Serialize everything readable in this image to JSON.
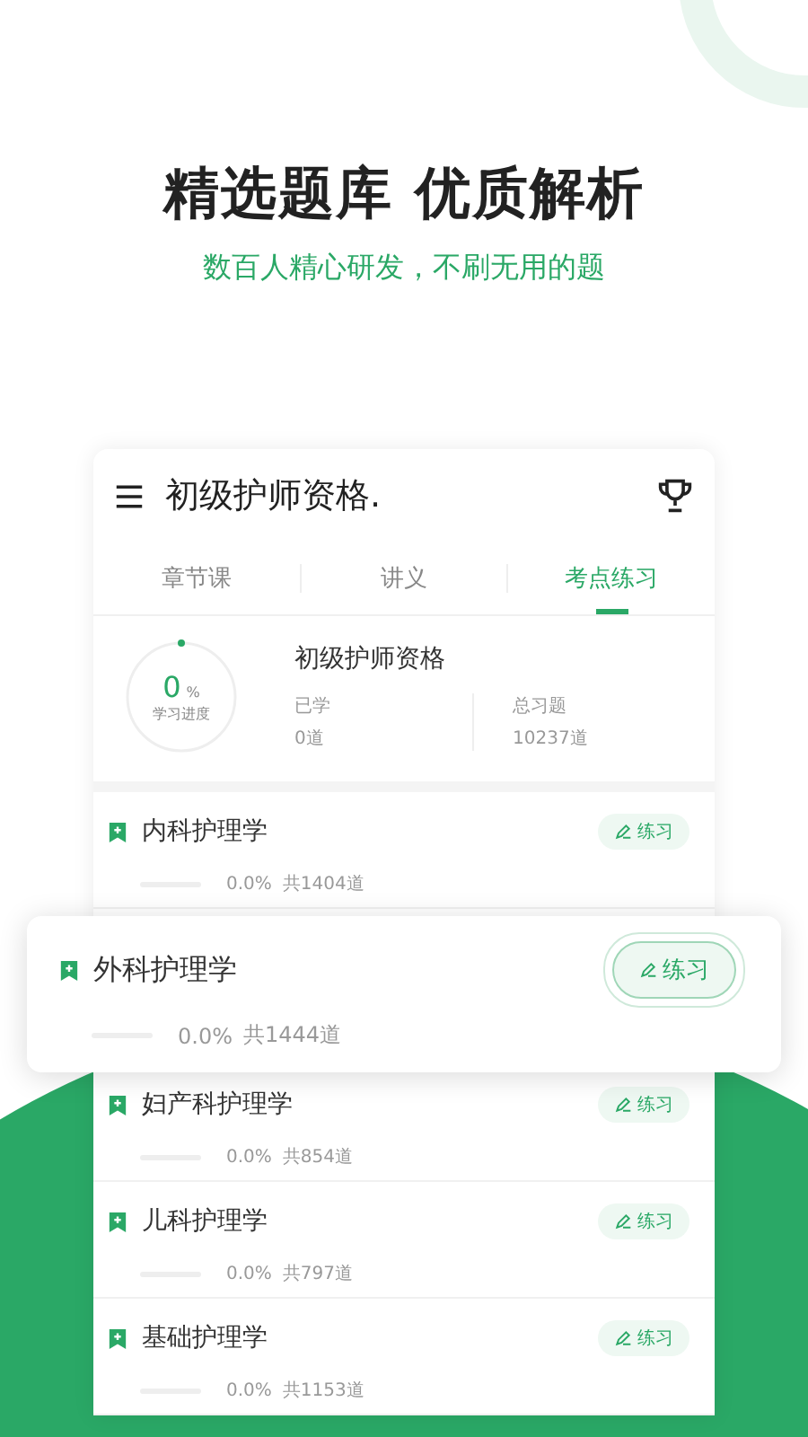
{
  "headline": "精选题库 优质解析",
  "subtitle": "数百人精心研发，不刷无用的题",
  "app": {
    "title": "初级护师资格.",
    "tabs": [
      {
        "label": "章节课",
        "selected": false
      },
      {
        "label": "讲义",
        "selected": false
      },
      {
        "label": "考点练习",
        "selected": true
      }
    ],
    "summary": {
      "percent": "0",
      "unit": "%",
      "progress_label": "学习进度",
      "name": "初级护师资格",
      "learned_label": "已学",
      "learned_value": "0道",
      "total_label": "总习题",
      "total_value": "10237道"
    },
    "subjects": [
      {
        "name": "内科护理学",
        "percent": "0.0%",
        "count": "共1404道",
        "button": "练习",
        "highlighted": false
      },
      {
        "name": "外科护理学",
        "percent": "0.0%",
        "count": "共1444道",
        "button": "练习",
        "highlighted": true
      },
      {
        "name": "妇产科护理学",
        "percent": "0.0%",
        "count": "共854道",
        "button": "练习",
        "highlighted": false
      },
      {
        "name": "儿科护理学",
        "percent": "0.0%",
        "count": "共797道",
        "button": "练习",
        "highlighted": false
      },
      {
        "name": "基础护理学",
        "percent": "0.0%",
        "count": "共1153道",
        "button": "练习",
        "highlighted": false
      }
    ]
  }
}
